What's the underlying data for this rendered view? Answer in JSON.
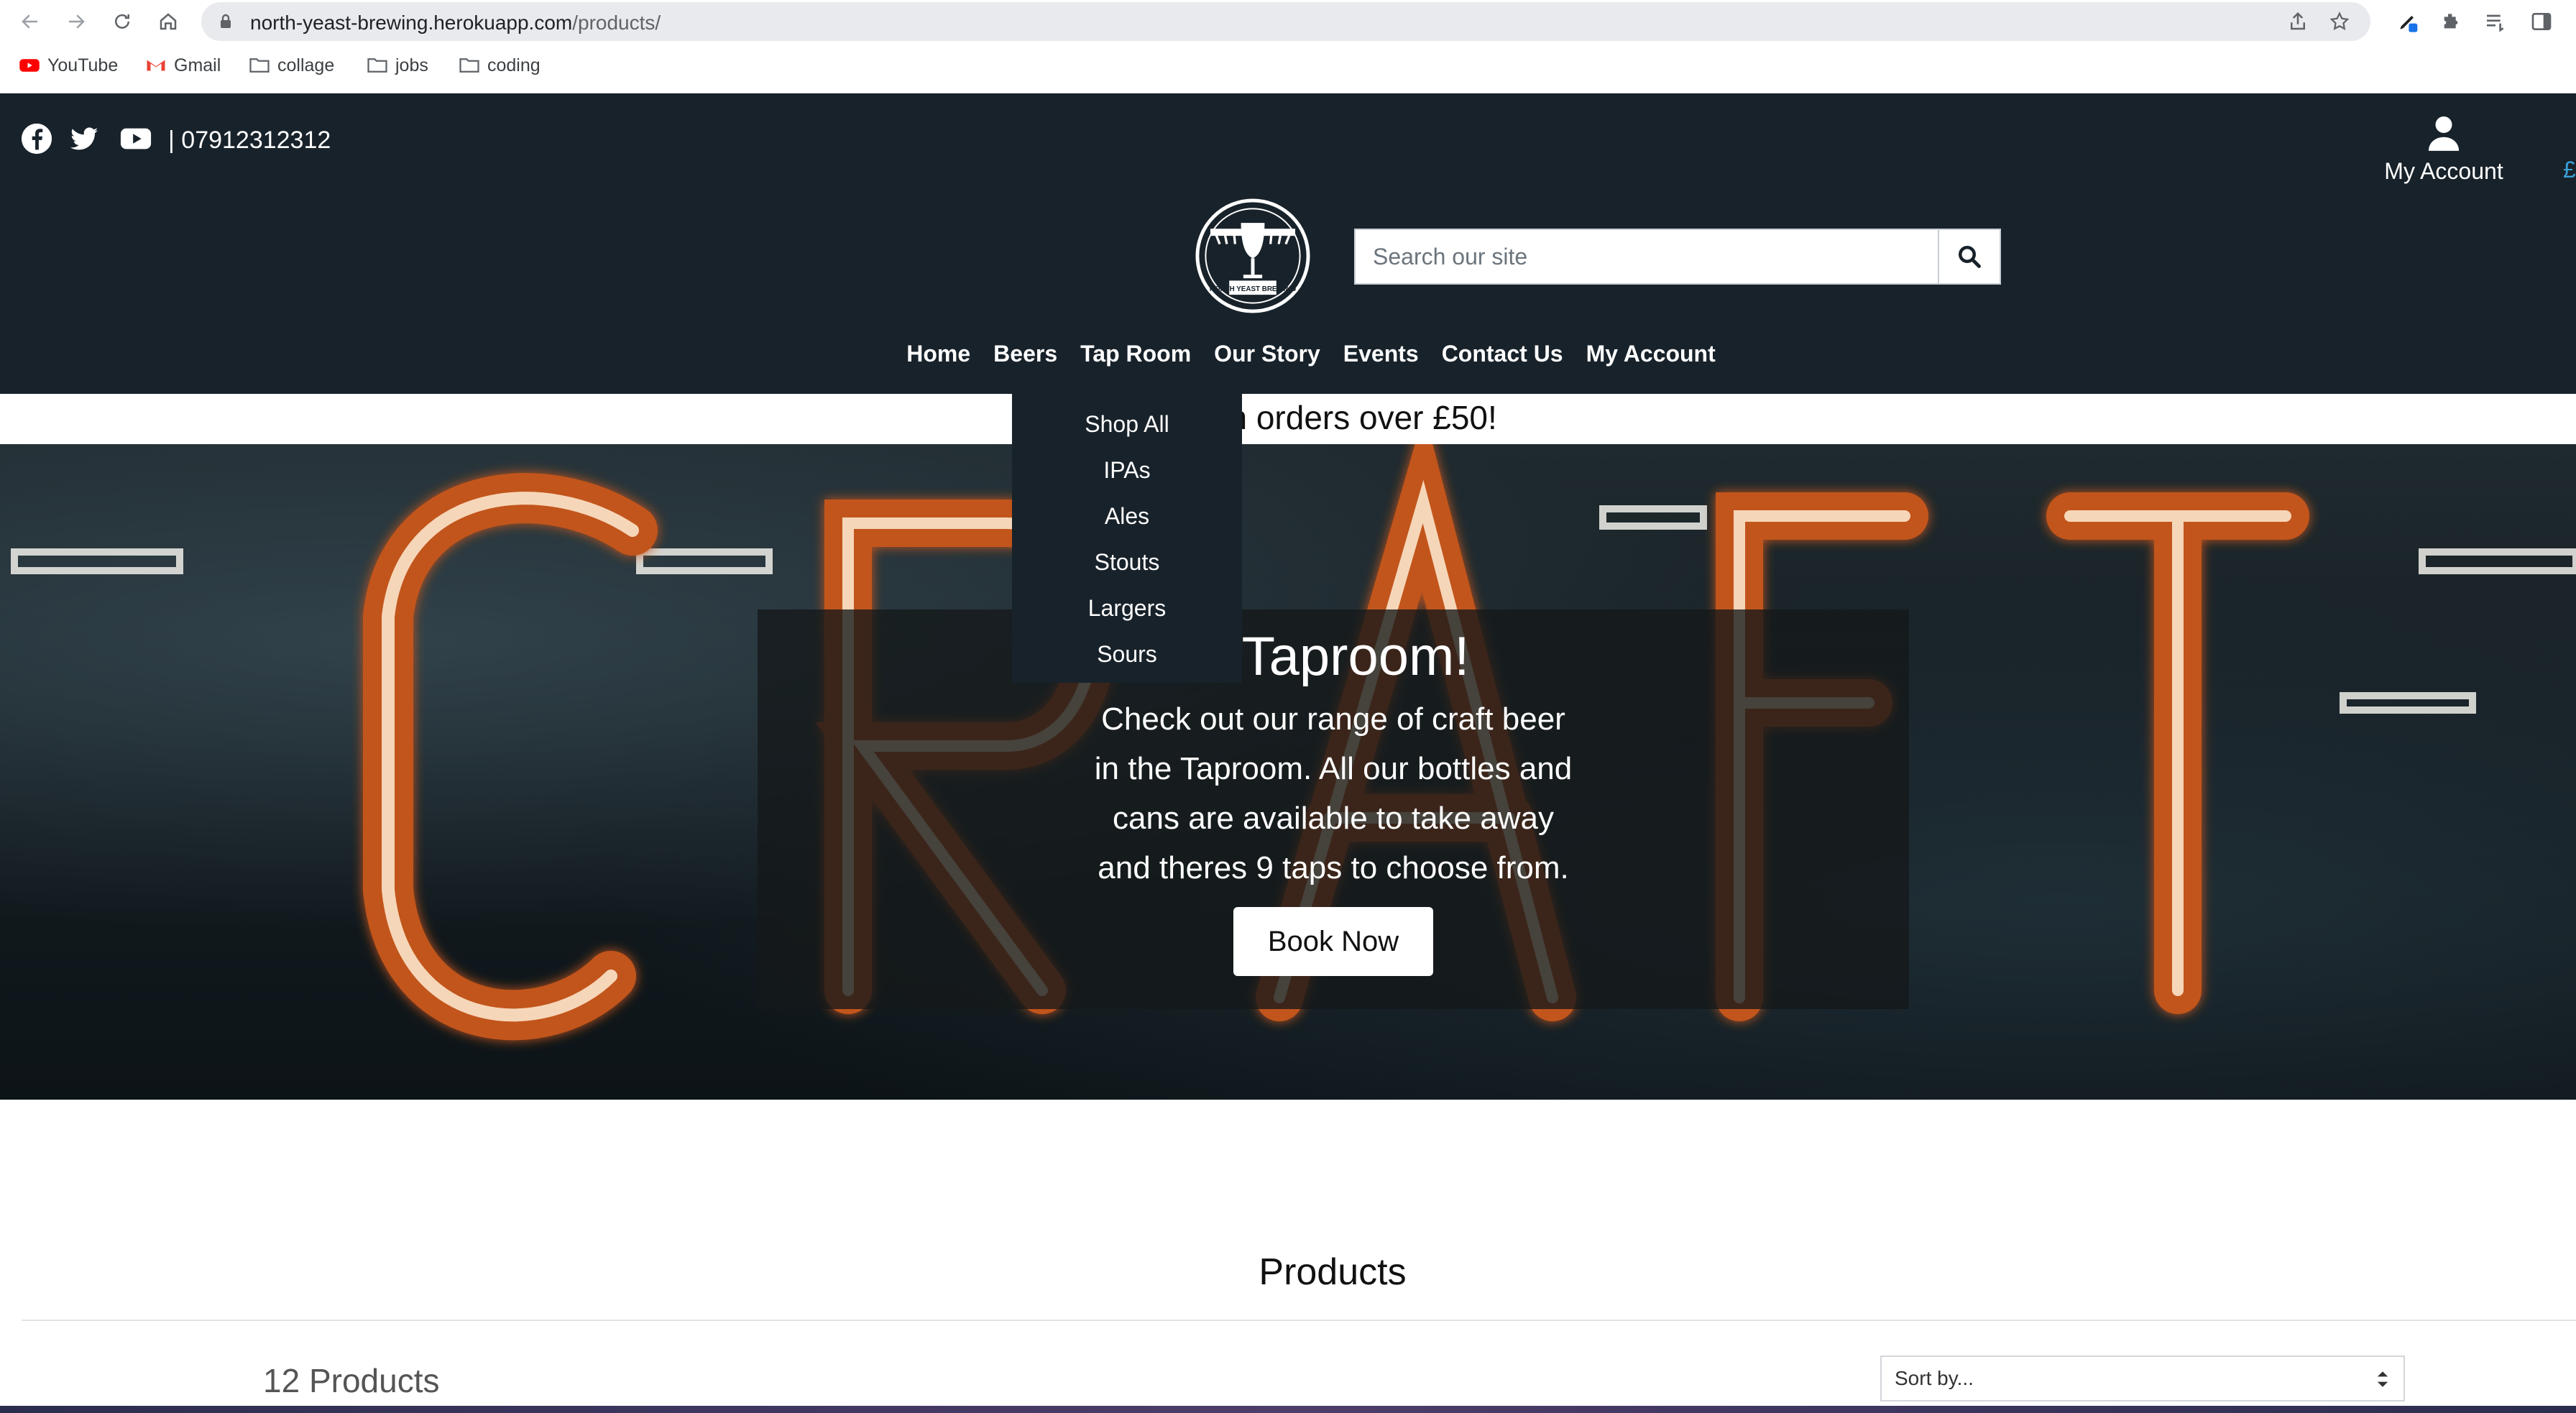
{
  "browser": {
    "url_host": "north-yeast-brewing.herokuapp.com",
    "url_path": "/products/",
    "bookmarks": [
      {
        "label": "YouTube",
        "icon": "youtube-icon"
      },
      {
        "label": "Gmail",
        "icon": "gmail-icon"
      },
      {
        "label": "collage",
        "icon": "folder-icon"
      },
      {
        "label": "jobs",
        "icon": "folder-icon"
      },
      {
        "label": "coding",
        "icon": "folder-icon"
      }
    ]
  },
  "header": {
    "phone": "| 07912312312",
    "account_label": "My Account",
    "basket_edge": "£",
    "logo_text": "NORTH YEAST BREWING",
    "search_placeholder": "Search our site",
    "accent_color": "#3aa0d8",
    "bg_color": "#18222a"
  },
  "nav": {
    "items": [
      "Home",
      "Beers",
      "Tap Room",
      "Our Story",
      "Events",
      "Contact Us",
      "My Account"
    ]
  },
  "dropdown": {
    "items": [
      "Shop All",
      "IPAs",
      "Ales",
      "Stouts",
      "Largers",
      "Sours"
    ]
  },
  "banner": {
    "text": "ery on orders over £50!"
  },
  "hero": {
    "title": "e Taproom!",
    "text": "Check out our range of craft beer in the Taproom. All our bottles and cans are available to take away and theres 9 taps to choose from.",
    "button": "Book Now"
  },
  "products": {
    "title": "Products",
    "count": "12 Products",
    "sort_value": "Sort by..."
  }
}
